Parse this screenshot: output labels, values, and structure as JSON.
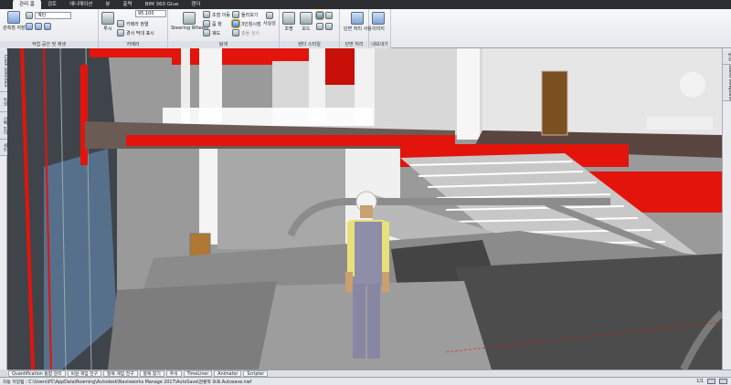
{
  "ribbon": {
    "tabs": [
      "",
      "관리 홈",
      "검토",
      "애니메이션",
      "뷰",
      "출력",
      "BIM 360 Glue",
      "렌더",
      ""
    ],
    "active_tab_index": 1,
    "panels": {
      "selection": {
        "title": "작업 공간 및 재생",
        "save_view_label": "관측점 저장",
        "play_label": "계단",
        "icon_label": "기본 전체"
      },
      "camera": {
        "title": "카메라",
        "perspective_label": "투시",
        "align_label": "카메라 정렬",
        "show_tilt_label": "경사 막대 표시",
        "fov_value": "95.100"
      },
      "navigate": {
        "title": "탐색",
        "steering_label": "Steering Wheels",
        "pan_label": "초점 이동",
        "zoom_label": "줌 창",
        "orbit_label": "궤도",
        "walk_label": "둘러보기",
        "third_person_label": "3인칭시점",
        "realism_label": "사실성",
        "sub_label": "충돌 검사"
      },
      "render_style": {
        "title": "렌더 스타일",
        "light_label": "조명",
        "mode_label": "모드"
      },
      "section": {
        "title": "단면 처리",
        "enable_label": "단면 처리 사용"
      },
      "export": {
        "title": "내보내기",
        "image_label": "이미지"
      }
    }
  },
  "left_dock_tabs": [
    "Clash Detective",
    "특성",
    "선택 트리",
    "세트"
  ],
  "right_dock_tabs": [
    "특성",
    "Saved Viewpoints"
  ],
  "bottom_tabs": [
    "Quantification 통합 관리",
    "비원 게임 전구",
    "항목 게임 전구",
    "항목 찾기",
    "주석",
    "TimeLiner",
    "Animator",
    "Scripter"
  ],
  "status": {
    "text": "자동 저장됨 : C:\\Users\\PC\\AppData\\Roaming\\Autodesk\\Navisworks Manage 2017\\AutoSave\\현황학 프로.Autosave.nwf",
    "page": "1/1"
  },
  "colors": {
    "accent_red": "#e2140c",
    "ribbon_dark": "#2b2d31",
    "floor_gray": "#8b8b8b"
  }
}
